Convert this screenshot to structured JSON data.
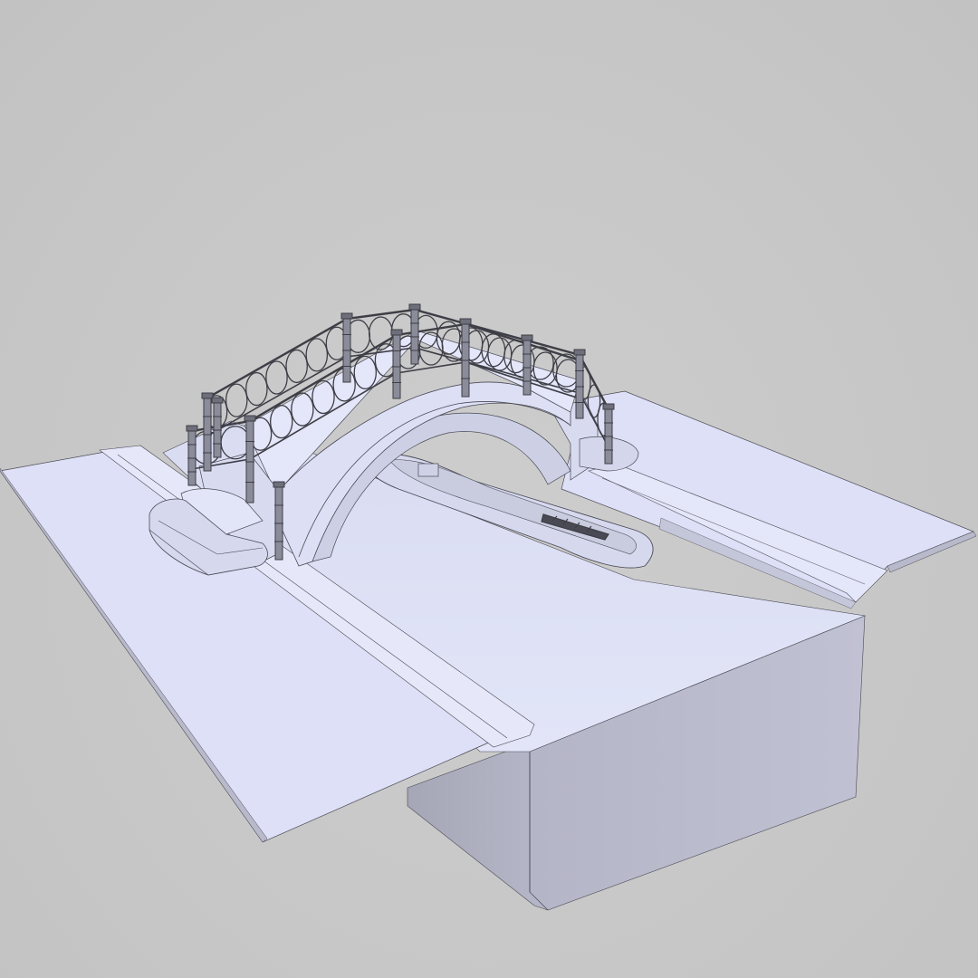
{
  "scene": {
    "subject": "wireframe-render",
    "colors": {
      "background": "#c8c8c8",
      "surface": "#dfe2f7",
      "surface_shade": "#c9ccdf",
      "side_face": "#b9bacb",
      "side_face_dark": "#a8a9bb",
      "wire": "#4a4a55",
      "rail": "#3e3e46",
      "boat": "#d6d9ee"
    },
    "bridge": {
      "post_count": 12,
      "railing_loops_per_side": 12
    },
    "boat": {
      "count": 1
    }
  }
}
